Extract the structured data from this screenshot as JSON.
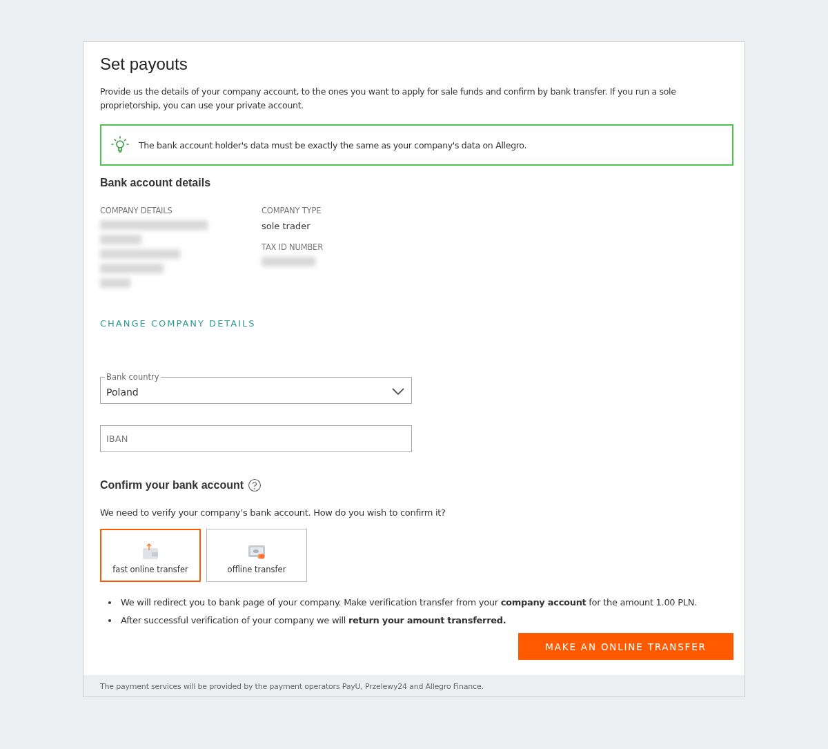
{
  "title": "Set payouts",
  "intro": "Provide us the details of your company account, to the ones you want to apply for sale funds and confirm by bank transfer. If you run a sole proprietorship, you can use your private account.",
  "notice": "The bank account holder's data must be exactly the same as your company's data on Allegro.",
  "bank_section": {
    "heading": "Bank account details",
    "company_details": {
      "label": "COMPANY DETAILS"
    },
    "company_type": {
      "label": "COMPANY TYPE",
      "value": "sole trader"
    },
    "tax_id": {
      "label": "TAX ID NUMBER"
    },
    "change_link": "CHANGE COMPANY DETAILS"
  },
  "bank_country": {
    "label": "Bank country",
    "value": "Poland"
  },
  "iban": {
    "placeholder": "IBAN"
  },
  "confirm_section": {
    "heading": "Confirm your bank account",
    "text": "We need to verify your company’s bank account. How do you wish to confirm it?",
    "options": [
      {
        "kind": "online",
        "label": "fast online transfer",
        "selected": true
      },
      {
        "kind": "offline",
        "label": "offline transfer",
        "selected": false
      }
    ],
    "bullets": [
      "We will redirect you to bank page of your company. Make verification transfer from your **company account** for the amount 1.00 PLN.",
      "After successful verification of your company we will **return your amount transferred.**"
    ],
    "button": "MAKE AN ONLINE TRANSFER"
  },
  "footer": "The payment services will be provided by the payment operators PayU, Przelewy24 and Allegro Finance."
}
